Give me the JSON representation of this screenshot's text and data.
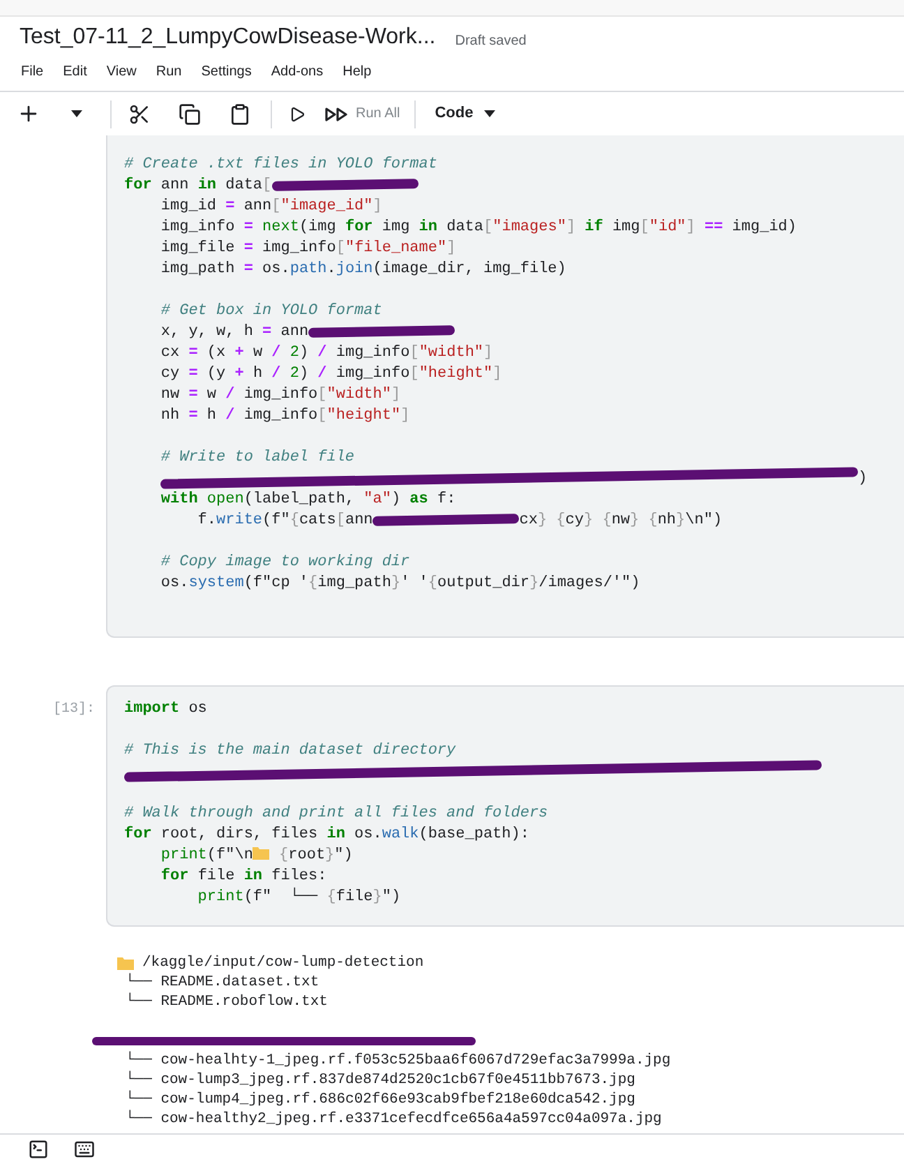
{
  "notebook": {
    "title": "Test_07-11_2_LumpyCowDisease-Work...",
    "save_status": "Draft saved"
  },
  "menu": [
    "File",
    "Edit",
    "View",
    "Run",
    "Settings",
    "Add-ons",
    "Help"
  ],
  "toolbar": {
    "run_all": "Run All",
    "cell_type": "Code"
  },
  "cells": [
    {
      "lines": [
        {
          "kind": "code",
          "tokens": [
            {
              "kind": "comment",
              "text": "# Create .txt files in YOLO format"
            }
          ]
        },
        {
          "kind": "code",
          "tokens": [
            {
              "kind": "keyword",
              "text": "for"
            },
            {
              "kind": "plain",
              "text": " ann "
            },
            {
              "kind": "keyword",
              "text": "in"
            },
            {
              "kind": "plain",
              "text": " data"
            },
            {
              "kind": "punct",
              "text": "["
            },
            {
              "kind": "scribble"
            }
          ]
        },
        {
          "kind": "code",
          "tokens": [
            {
              "kind": "plain",
              "text": "    img_id "
            },
            {
              "kind": "operator",
              "text": "="
            },
            {
              "kind": "plain",
              "text": " ann"
            },
            {
              "kind": "punct",
              "text": "["
            },
            {
              "kind": "string",
              "text": "\"image_id\""
            },
            {
              "kind": "punct",
              "text": "]"
            }
          ]
        },
        {
          "kind": "code",
          "tokens": [
            {
              "kind": "plain",
              "text": "    img_info "
            },
            {
              "kind": "operator",
              "text": "="
            },
            {
              "kind": "builtin",
              "text": " next"
            },
            {
              "kind": "plain",
              "text": "(img "
            },
            {
              "kind": "keyword",
              "text": "for"
            },
            {
              "kind": "plain",
              "text": " img "
            },
            {
              "kind": "keyword",
              "text": "in"
            },
            {
              "kind": "plain",
              "text": " data"
            },
            {
              "kind": "punct",
              "text": "["
            },
            {
              "kind": "string",
              "text": "\"images\""
            },
            {
              "kind": "punct",
              "text": "]"
            },
            {
              "kind": "keyword",
              "text": " if"
            },
            {
              "kind": "plain",
              "text": " img"
            },
            {
              "kind": "punct",
              "text": "["
            },
            {
              "kind": "string",
              "text": "\"id\""
            },
            {
              "kind": "punct",
              "text": "]"
            },
            {
              "kind": "operator",
              "text": " =="
            },
            {
              "kind": "plain",
              "text": " img_id)"
            }
          ]
        },
        {
          "kind": "code",
          "tokens": [
            {
              "kind": "plain",
              "text": "    img_file "
            },
            {
              "kind": "operator",
              "text": "="
            },
            {
              "kind": "plain",
              "text": " img_info"
            },
            {
              "kind": "punct",
              "text": "["
            },
            {
              "kind": "string",
              "text": "\"file_name\""
            },
            {
              "kind": "punct",
              "text": "]"
            }
          ]
        },
        {
          "kind": "code",
          "tokens": [
            {
              "kind": "plain",
              "text": "    img_path "
            },
            {
              "kind": "operator",
              "text": "="
            },
            {
              "kind": "plain",
              "text": " os."
            },
            {
              "kind": "attr",
              "text": "path"
            },
            {
              "kind": "plain",
              "text": "."
            },
            {
              "kind": "attr",
              "text": "join"
            },
            {
              "kind": "plain",
              "text": "(image_dir, img_file)"
            }
          ]
        },
        {
          "kind": "blank"
        },
        {
          "kind": "code",
          "tokens": [
            {
              "kind": "comment",
              "text": "    # Get box in YOLO format"
            }
          ]
        },
        {
          "kind": "code",
          "tokens": [
            {
              "kind": "plain",
              "text": "    x, y, w, h "
            },
            {
              "kind": "operator",
              "text": "="
            },
            {
              "kind": "plain",
              "text": " ann"
            },
            {
              "kind": "scribble"
            }
          ]
        },
        {
          "kind": "code",
          "tokens": [
            {
              "kind": "plain",
              "text": "    cx "
            },
            {
              "kind": "operator",
              "text": "="
            },
            {
              "kind": "plain",
              "text": " (x "
            },
            {
              "kind": "operator",
              "text": "+"
            },
            {
              "kind": "plain",
              "text": " w "
            },
            {
              "kind": "operator",
              "text": "/"
            },
            {
              "kind": "number",
              "text": " 2"
            },
            {
              "kind": "plain",
              "text": ") "
            },
            {
              "kind": "operator",
              "text": "/"
            },
            {
              "kind": "plain",
              "text": " img_info"
            },
            {
              "kind": "punct",
              "text": "["
            },
            {
              "kind": "string",
              "text": "\"width\""
            },
            {
              "kind": "punct",
              "text": "]"
            }
          ]
        },
        {
          "kind": "code",
          "tokens": [
            {
              "kind": "plain",
              "text": "    cy "
            },
            {
              "kind": "operator",
              "text": "="
            },
            {
              "kind": "plain",
              "text": " (y "
            },
            {
              "kind": "operator",
              "text": "+"
            },
            {
              "kind": "plain",
              "text": " h "
            },
            {
              "kind": "operator",
              "text": "/"
            },
            {
              "kind": "number",
              "text": " 2"
            },
            {
              "kind": "plain",
              "text": ") "
            },
            {
              "kind": "operator",
              "text": "/"
            },
            {
              "kind": "plain",
              "text": " img_info"
            },
            {
              "kind": "punct",
              "text": "["
            },
            {
              "kind": "string",
              "text": "\"height\""
            },
            {
              "kind": "punct",
              "text": "]"
            }
          ]
        },
        {
          "kind": "code",
          "tokens": [
            {
              "kind": "plain",
              "text": "    nw "
            },
            {
              "kind": "operator",
              "text": "="
            },
            {
              "kind": "plain",
              "text": " w "
            },
            {
              "kind": "operator",
              "text": "/"
            },
            {
              "kind": "plain",
              "text": " img_info"
            },
            {
              "kind": "punct",
              "text": "["
            },
            {
              "kind": "string",
              "text": "\"width\""
            },
            {
              "kind": "punct",
              "text": "]"
            }
          ]
        },
        {
          "kind": "code",
          "tokens": [
            {
              "kind": "plain",
              "text": "    nh "
            },
            {
              "kind": "operator",
              "text": "="
            },
            {
              "kind": "plain",
              "text": " h "
            },
            {
              "kind": "operator",
              "text": "/"
            },
            {
              "kind": "plain",
              "text": " img_info"
            },
            {
              "kind": "punct",
              "text": "["
            },
            {
              "kind": "string",
              "text": "\"height\""
            },
            {
              "kind": "punct",
              "text": "]"
            }
          ]
        },
        {
          "kind": "blank"
        },
        {
          "kind": "code",
          "tokens": [
            {
              "kind": "comment",
              "text": "    # Write to label file"
            }
          ]
        },
        {
          "kind": "code",
          "tokens": [
            {
              "kind": "indented_scribble_line"
            },
            {
              "kind": "plain",
              "text": ")"
            }
          ]
        },
        {
          "kind": "code",
          "tokens": [
            {
              "kind": "keyword",
              "text": "    with"
            },
            {
              "kind": "builtin",
              "text": " open"
            },
            {
              "kind": "plain",
              "text": "(label_path, "
            },
            {
              "kind": "string",
              "text": "\"a\""
            },
            {
              "kind": "plain",
              "text": ") "
            },
            {
              "kind": "keyword",
              "text": "as"
            },
            {
              "kind": "plain",
              "text": " f:"
            }
          ]
        },
        {
          "kind": "code",
          "tokens": [
            {
              "kind": "plain",
              "text": "        f."
            },
            {
              "kind": "attr",
              "text": "write"
            },
            {
              "kind": "plain",
              "text": "(f\""
            },
            {
              "kind": "punct",
              "text": "{"
            },
            {
              "kind": "plain",
              "text": "cats"
            },
            {
              "kind": "punct",
              "text": "["
            },
            {
              "kind": "plain",
              "text": "ann"
            },
            {
              "kind": "scribble"
            },
            {
              "kind": "plain",
              "text": "cx"
            },
            {
              "kind": "punct",
              "text": "} {"
            },
            {
              "kind": "plain",
              "text": "cy"
            },
            {
              "kind": "punct",
              "text": "} {"
            },
            {
              "kind": "plain",
              "text": "nw"
            },
            {
              "kind": "punct",
              "text": "} {"
            },
            {
              "kind": "plain",
              "text": "nh"
            },
            {
              "kind": "punct",
              "text": "}"
            },
            {
              "kind": "plain",
              "text": "\\n\")"
            }
          ]
        },
        {
          "kind": "blank"
        },
        {
          "kind": "code",
          "tokens": [
            {
              "kind": "comment",
              "text": "    # Copy image to working dir"
            }
          ]
        },
        {
          "kind": "code",
          "tokens": [
            {
              "kind": "plain",
              "text": "    os."
            },
            {
              "kind": "attr",
              "text": "system"
            },
            {
              "kind": "plain",
              "text": "(f\"cp '"
            },
            {
              "kind": "punct",
              "text": "{"
            },
            {
              "kind": "plain",
              "text": "img_path"
            },
            {
              "kind": "punct",
              "text": "}"
            },
            {
              "kind": "plain",
              "text": "' '"
            },
            {
              "kind": "punct",
              "text": "{"
            },
            {
              "kind": "plain",
              "text": "output_dir"
            },
            {
              "kind": "punct",
              "text": "}"
            },
            {
              "kind": "plain",
              "text": "/images/'\")"
            }
          ]
        }
      ]
    },
    {
      "prompt": "[13]:",
      "lines": [
        {
          "kind": "code",
          "tokens": [
            {
              "kind": "keyword",
              "text": "import"
            },
            {
              "kind": "plain",
              "text": " os"
            }
          ]
        },
        {
          "kind": "blank"
        },
        {
          "kind": "code",
          "tokens": [
            {
              "kind": "comment",
              "text": "# This is the main dataset directory"
            }
          ]
        },
        {
          "kind": "code",
          "tokens": [
            {
              "kind": "scribble_line"
            }
          ]
        },
        {
          "kind": "blank"
        },
        {
          "kind": "code",
          "tokens": [
            {
              "kind": "comment",
              "text": "# Walk through and print all files and folders"
            }
          ]
        },
        {
          "kind": "code",
          "tokens": [
            {
              "kind": "keyword",
              "text": "for"
            },
            {
              "kind": "plain",
              "text": " root, dirs, files "
            },
            {
              "kind": "keyword",
              "text": "in"
            },
            {
              "kind": "plain",
              "text": " os."
            },
            {
              "kind": "attr",
              "text": "walk"
            },
            {
              "kind": "plain",
              "text": "(base_path):"
            }
          ]
        },
        {
          "kind": "code",
          "tokens": [
            {
              "kind": "builtin",
              "text": "    print"
            },
            {
              "kind": "plain",
              "text": "(f\"\\n"
            },
            {
              "kind": "folder"
            },
            {
              "kind": "punct",
              "text": " {"
            },
            {
              "kind": "plain",
              "text": "root"
            },
            {
              "kind": "punct",
              "text": "}"
            },
            {
              "kind": "plain",
              "text": "\")"
            }
          ]
        },
        {
          "kind": "code",
          "tokens": [
            {
              "kind": "keyword",
              "text": "    for"
            },
            {
              "kind": "plain",
              "text": " file "
            },
            {
              "kind": "keyword",
              "text": "in"
            },
            {
              "kind": "plain",
              "text": " files:"
            }
          ]
        },
        {
          "kind": "code",
          "tokens": [
            {
              "kind": "builtin",
              "text": "        print"
            },
            {
              "kind": "plain",
              "text": "(f\"  └── "
            },
            {
              "kind": "punct",
              "text": "{"
            },
            {
              "kind": "plain",
              "text": "file"
            },
            {
              "kind": "punct",
              "text": "}"
            },
            {
              "kind": "plain",
              "text": "\")"
            }
          ]
        }
      ]
    }
  ],
  "output": [
    {
      "kind": "folder",
      "text": "/kaggle/input/cow-lump-detection"
    },
    {
      "kind": "file",
      "text": "└── README.dataset.txt"
    },
    {
      "kind": "file",
      "text": "└── README.roboflow.txt"
    },
    {
      "kind": "blank"
    },
    {
      "kind": "scribble"
    },
    {
      "kind": "file",
      "text": "└── cow-healhty-1_jpeg.rf.f053c525baa6f6067d729efac3a7999a.jpg"
    },
    {
      "kind": "file",
      "text": "└── cow-lump3_jpeg.rf.837de874d2520c1cb67f0e4511bb7673.jpg"
    },
    {
      "kind": "file",
      "text": "└── cow-lump4_jpeg.rf.686c02f66e93cab9fbef218e60dca542.jpg"
    },
    {
      "kind": "file",
      "text": "└── cow-healthy2_jpeg.rf.e3371cefecdfce656a4a597cc04a097a.jpg"
    }
  ]
}
